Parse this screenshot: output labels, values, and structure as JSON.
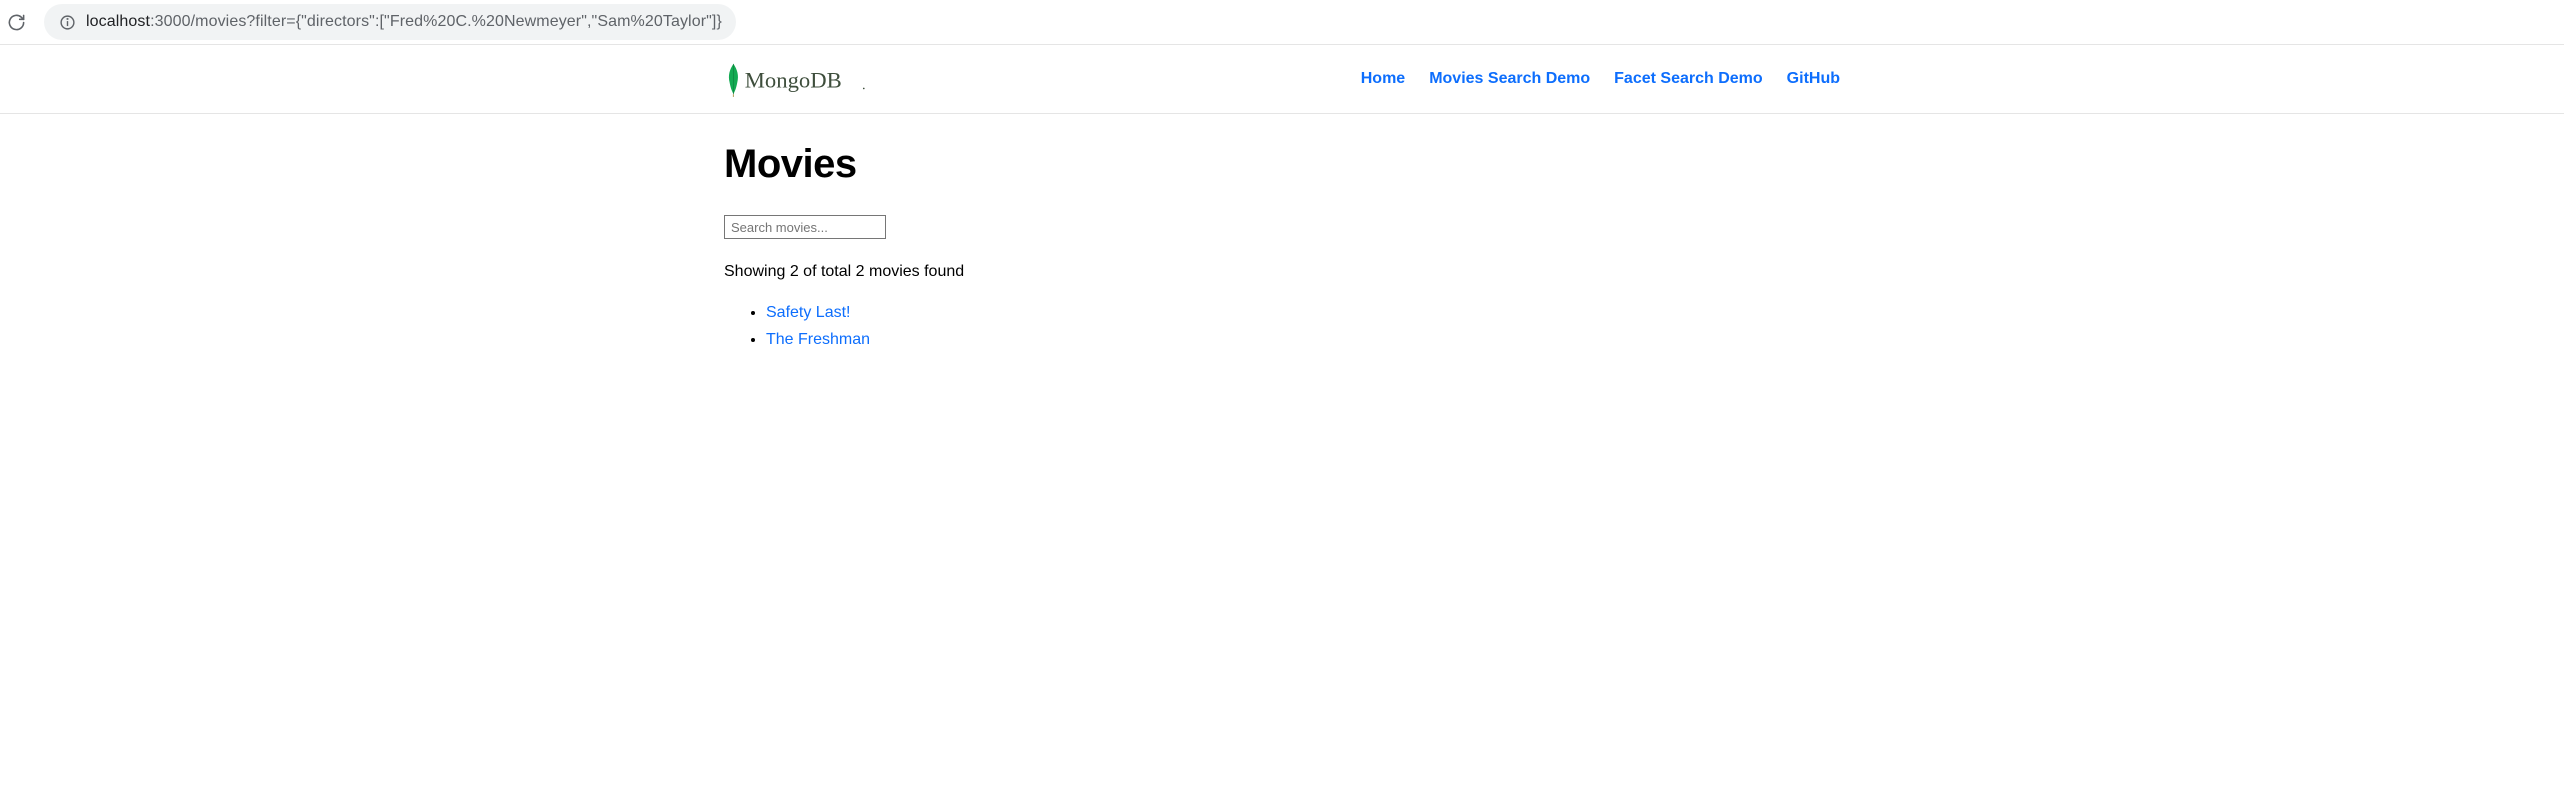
{
  "browser": {
    "url_host": "localhost",
    "url_path": ":3000/movies?filter={\"directors\":[\"Fred%20C.%20Newmeyer\",\"Sam%20Taylor\"]}"
  },
  "header": {
    "logo_text": "MongoDB",
    "nav": [
      {
        "label": "Home"
      },
      {
        "label": "Movies Search Demo"
      },
      {
        "label": "Facet Search Demo"
      },
      {
        "label": "GitHub"
      }
    ]
  },
  "main": {
    "title": "Movies",
    "search_placeholder": "Search movies...",
    "status": "Showing 2 of total 2 movies found",
    "movies": [
      {
        "title": "Safety Last!"
      },
      {
        "title": "The Freshman"
      }
    ]
  }
}
